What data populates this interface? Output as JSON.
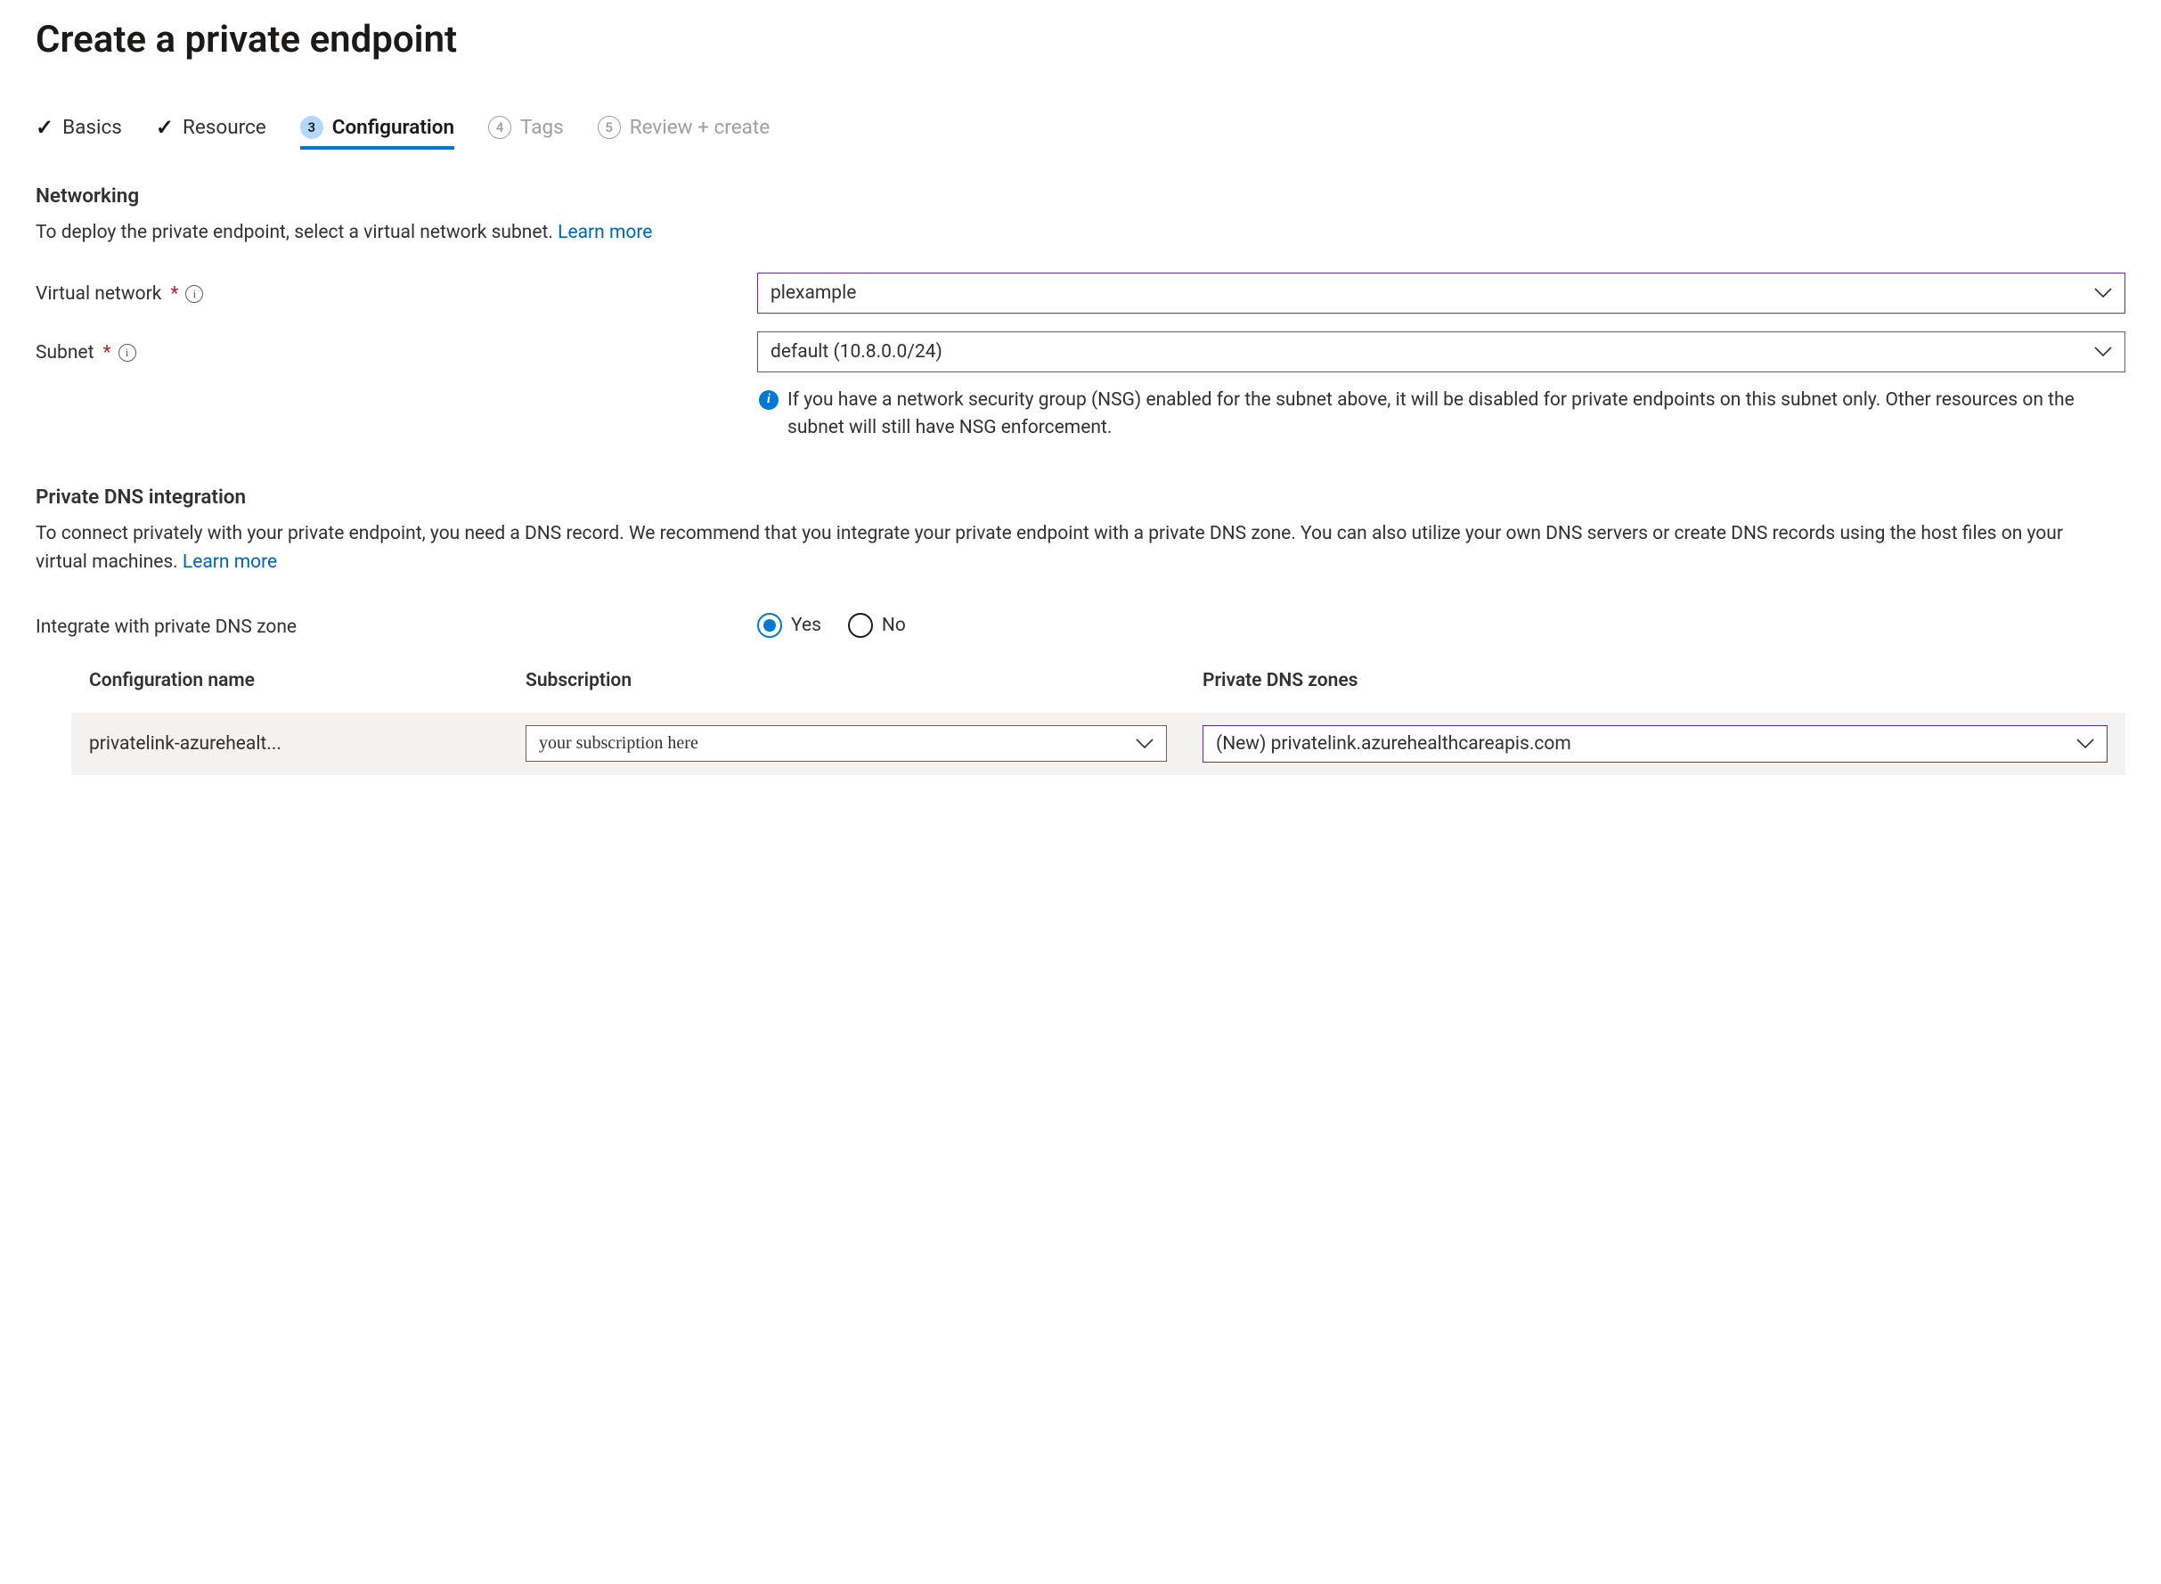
{
  "page": {
    "title": "Create a private endpoint"
  },
  "steps": {
    "basics": {
      "label": "Basics",
      "completed": true
    },
    "resource": {
      "label": "Resource",
      "completed": true
    },
    "config": {
      "label": "Configuration",
      "num": "3",
      "active": true
    },
    "tags": {
      "label": "Tags",
      "num": "4"
    },
    "review": {
      "label": "Review + create",
      "num": "5"
    }
  },
  "networking": {
    "heading": "Networking",
    "desc": "To deploy the private endpoint, select a virtual network subnet.  ",
    "learn": "Learn more",
    "vnet_label": "Virtual network",
    "vnet_value": "plexample",
    "subnet_label": "Subnet",
    "subnet_value": "default (10.8.0.0/24)",
    "note": "If you have a network security group (NSG) enabled for the subnet above, it will be disabled for private endpoints on this subnet only. Other resources on the subnet will still have NSG enforcement."
  },
  "dns": {
    "heading": "Private DNS integration",
    "desc": "To connect privately with your private endpoint, you need a DNS record. We recommend that you integrate your private endpoint with a private DNS zone. You can also utilize your own DNS servers or create DNS records using the host files on your virtual machines.  ",
    "learn": "Learn more",
    "integrate_label": "Integrate with private DNS zone",
    "yes": "Yes",
    "no": "No",
    "table": {
      "headers": {
        "config": "Configuration name",
        "sub": "Subscription",
        "zone": "Private DNS zones"
      },
      "row": {
        "config": "privatelink-azurehealt...",
        "sub": "your subscription here",
        "zone": "(New) privatelink.azurehealthcareapis.com"
      }
    }
  }
}
